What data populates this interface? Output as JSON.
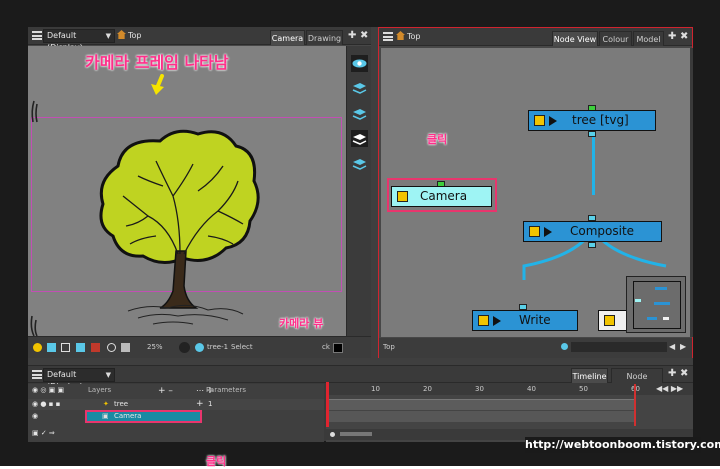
{
  "camera_view": {
    "display_dropdown": "Default (Display)",
    "top_label": "Top",
    "tabs": [
      "Camera",
      "Drawing"
    ],
    "annotation_title": "카메라 프레임 나타남",
    "annotation_bottom": "카메라 뷰",
    "zoom": "25%",
    "drawing_name": "tree-1",
    "tool_name": "Select",
    "status_right": "ck"
  },
  "node_view": {
    "top_label": "Top",
    "tabs": [
      "Node View",
      "Colour",
      "Model"
    ],
    "nodes": {
      "tree": "tree  [tvg]",
      "camera": "Camera",
      "composite": "Composite",
      "write": "Write"
    },
    "annotation_click": "클릭",
    "bottom_label": "Top",
    "colors": {
      "node_fill": "#2b93d4",
      "selected_node_fill": "#9ef4f4",
      "wire": "#22b3e8",
      "annotation": "#ff2f8a"
    }
  },
  "timeline": {
    "display_dropdown": "Default (Display)",
    "layers_header": "Layers",
    "parameters_header": "Parameters",
    "tabs": [
      "Timeline",
      "Node Library"
    ],
    "ruler": [
      "10",
      "20",
      "30",
      "40",
      "50",
      "60"
    ],
    "layers": [
      {
        "name": "tree",
        "param": "1"
      },
      {
        "name": "Camera",
        "param": ""
      }
    ],
    "annotation_click": "클릭"
  },
  "watermark": "http://webtoonboom.tistory.com"
}
